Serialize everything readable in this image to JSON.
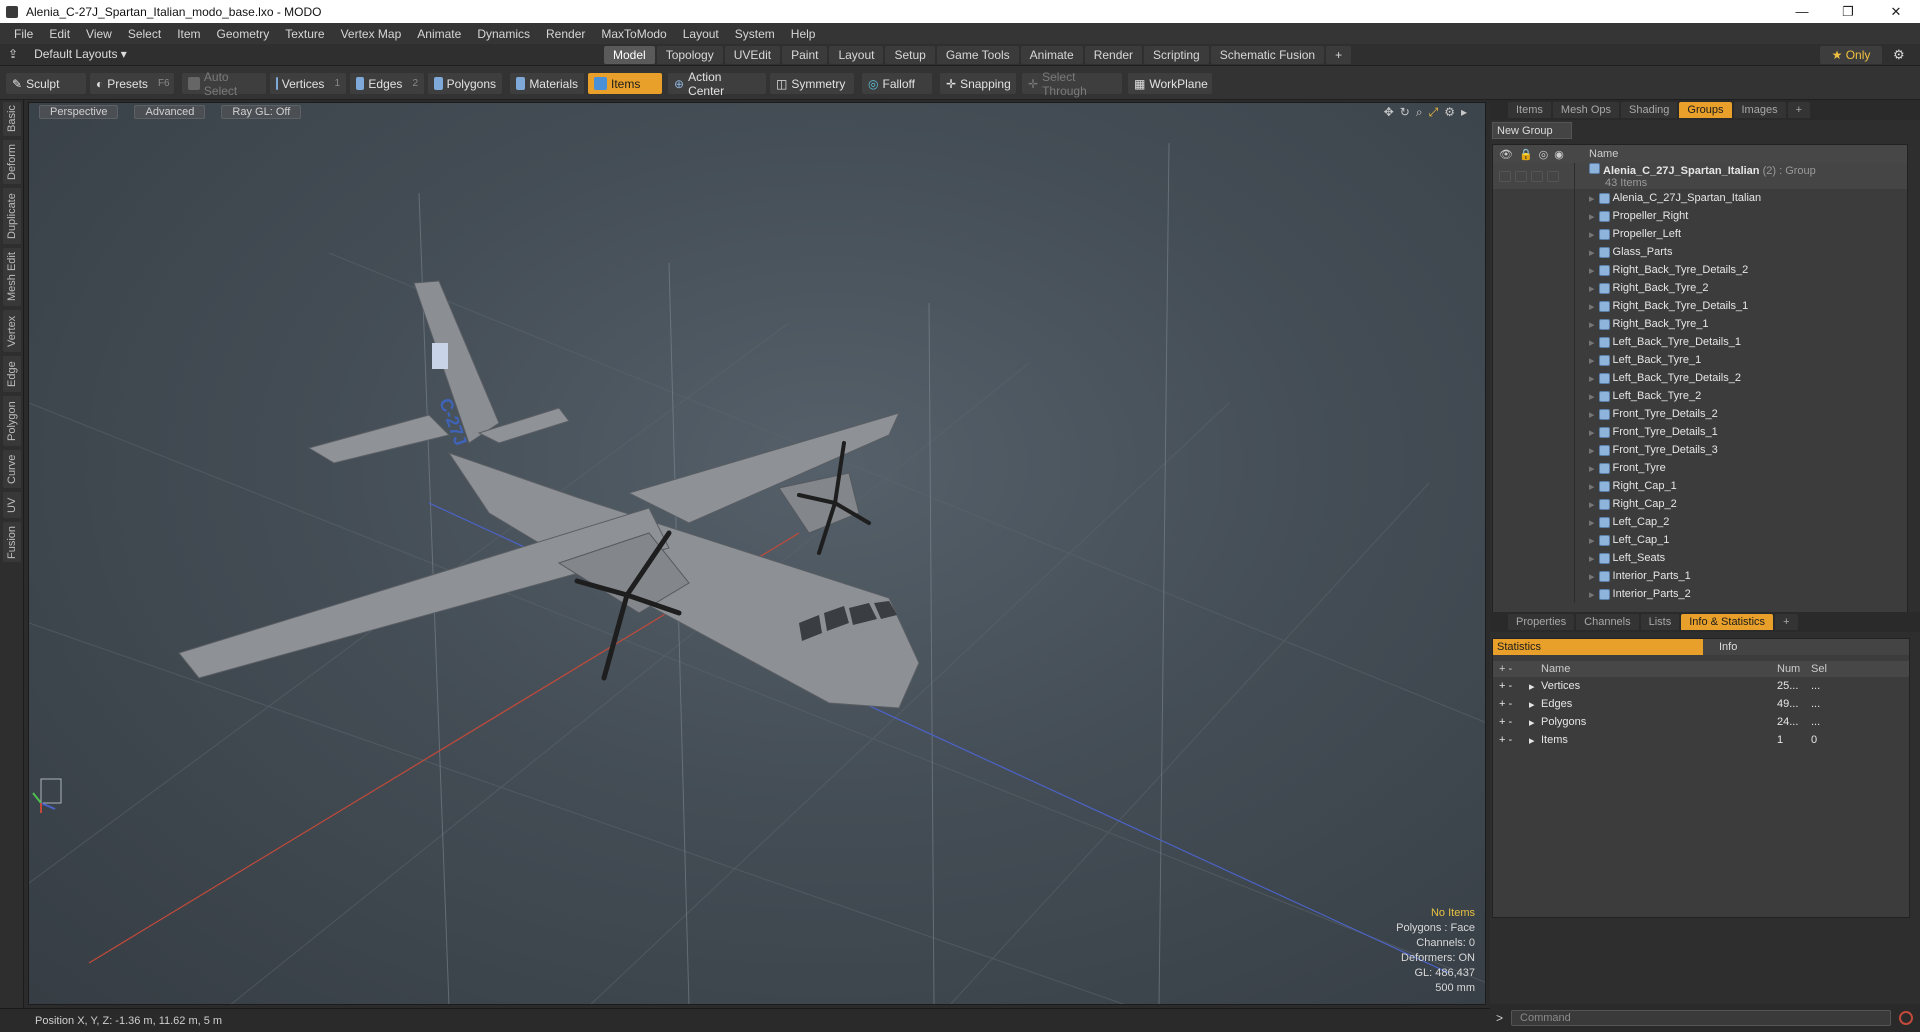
{
  "window": {
    "title": "Alenia_C-27J_Spartan_Italian_modo_base.lxo - MODO",
    "minimize": "—",
    "maximize": "❐",
    "close": "✕"
  },
  "menu": [
    "File",
    "Edit",
    "View",
    "Select",
    "Item",
    "Geometry",
    "Texture",
    "Vertex Map",
    "Animate",
    "Dynamics",
    "Render",
    "MaxToModo",
    "Layout",
    "System",
    "Help"
  ],
  "layoutbar": {
    "layout": "Default Layouts ▾",
    "only": "★ Only",
    "tabs": [
      "Model",
      "Topology",
      "UVEdit",
      "Paint",
      "Layout",
      "Setup",
      "Game Tools",
      "Animate",
      "Render",
      "Scripting",
      "Schematic Fusion"
    ],
    "active_tab": "Model"
  },
  "toolbar": {
    "sculpt": "Sculpt",
    "presets": "Presets",
    "presets_key": "F6",
    "auto_select": "Auto Select",
    "vertices": "Vertices",
    "vertices_n": "1",
    "edges": "Edges",
    "edges_n": "2",
    "polygons": "Polygons",
    "materials": "Materials",
    "items": "Items",
    "action_center": "Action Center",
    "symmetry": "Symmetry",
    "falloff": "Falloff",
    "snapping": "Snapping",
    "select_through": "Select Through",
    "workplane": "WorkPlane"
  },
  "lefttabs": [
    "Basic",
    "Deform",
    "Duplicate",
    "Mesh Edit",
    "Vertex",
    "Edge",
    "Polygon",
    "Curve",
    "UV",
    "Fusion"
  ],
  "viewport": {
    "perspective": "Perspective",
    "advanced": "Advanced",
    "raygl": "Ray GL: Off",
    "info": {
      "no_items": "No Items",
      "polygons": "Polygons : Face",
      "channels": "Channels: 0",
      "deformers": "Deformers: ON",
      "gl": "GL: 486,437",
      "scale": "500 mm"
    },
    "tail_text": "C-27J"
  },
  "status": {
    "position": "Position X, Y, Z:  -1.36 m, 11.62 m, 5 m"
  },
  "groups_panel": {
    "tabs": [
      "Items",
      "Mesh Ops",
      "Shading",
      "Groups",
      "Images"
    ],
    "active": "Groups",
    "new_group": "New Group",
    "col_name": "Name",
    "root": {
      "name": "Alenia_C_27J_Spartan_Italian",
      "suffix": "(2) : Group",
      "count": "43 Items"
    },
    "items": [
      "Alenia_C_27J_Spartan_Italian",
      "Propeller_Right",
      "Propeller_Left",
      "Glass_Parts",
      "Right_Back_Tyre_Details_2",
      "Right_Back_Tyre_2",
      "Right_Back_Tyre_Details_1",
      "Right_Back_Tyre_1",
      "Left_Back_Tyre_Details_1",
      "Left_Back_Tyre_1",
      "Left_Back_Tyre_Details_2",
      "Left_Back_Tyre_2",
      "Front_Tyre_Details_2",
      "Front_Tyre_Details_1",
      "Front_Tyre_Details_3",
      "Front_Tyre",
      "Right_Cap_1",
      "Right_Cap_2",
      "Left_Cap_2",
      "Left_Cap_1",
      "Left_Seats",
      "Interior_Parts_1",
      "Interior_Parts_2"
    ]
  },
  "stats_panel": {
    "tabs": [
      "Properties",
      "Channels",
      "Lists",
      "Info & Statistics"
    ],
    "active": "Info & Statistics",
    "statistics": "Statistics",
    "info": "Info",
    "col_name": "Name",
    "col_num": "Num",
    "col_sel": "Sel",
    "rows": [
      {
        "name": "Vertices",
        "num": "25...",
        "sel": "..."
      },
      {
        "name": "Edges",
        "num": "49...",
        "sel": "..."
      },
      {
        "name": "Polygons",
        "num": "24...",
        "sel": "..."
      },
      {
        "name": "Items",
        "num": "1",
        "sel": "0"
      }
    ]
  },
  "command": {
    "placeholder": "Command",
    "prompt": ">"
  }
}
